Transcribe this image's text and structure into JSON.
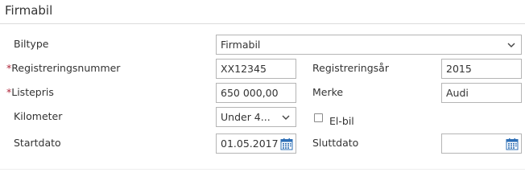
{
  "section": {
    "title": "Firmabil"
  },
  "form": {
    "biltype": {
      "label": "Biltype",
      "value": "Firmabil"
    },
    "registreringsnummer": {
      "required_mark": "*",
      "label": "Registreringsnummer",
      "value": "XX12345"
    },
    "registreringsar": {
      "label": "Registreringsår",
      "value": "2015"
    },
    "listepris": {
      "required_mark": "*",
      "label": "Listepris",
      "value": "650 000,00"
    },
    "merke": {
      "label": "Merke",
      "value": "Audi"
    },
    "kilometer": {
      "label": "Kilometer",
      "value": "Under 4..."
    },
    "elbil": {
      "label": "El-bil",
      "checked": false
    },
    "startdato": {
      "label": "Startdato",
      "value": "01.05.2017"
    },
    "sluttdato": {
      "label": "Sluttdato",
      "value": ""
    }
  },
  "icons": {
    "dropdown": "chevron-down-icon",
    "date": "calendar-icon"
  },
  "colors": {
    "required": "#b0263a",
    "calendar": "#2e6fb6",
    "border": "#b5b5b5"
  }
}
